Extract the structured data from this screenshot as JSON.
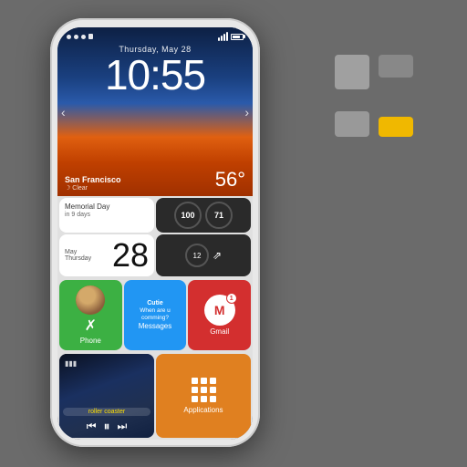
{
  "background_color": "#6b6b6b",
  "logo": {
    "blocks": [
      "gray-large",
      "gray-medium",
      "gray-small",
      "yellow"
    ]
  },
  "phone": {
    "status_bar": {
      "time": "10:55",
      "date": "Thursday, May 28",
      "signal": "4 bars",
      "wifi": true,
      "battery": "80%"
    },
    "clock": {
      "time": "10:55",
      "date": "Thursday, May 28"
    },
    "weather": {
      "city": "San Francisco",
      "condition": "Clear",
      "temperature": "56°"
    },
    "widgets": {
      "memorial": {
        "title": "Memorial Day",
        "subtitle": "in 9 days"
      },
      "date": {
        "day_name": "May",
        "day_sub": "Thursday",
        "number": "28"
      },
      "circles_top": {
        "val1": "100",
        "val2": "71"
      },
      "circles_bottom": {
        "val1": "12"
      }
    },
    "apps": {
      "phone": {
        "label": "Phone",
        "color": "#3cb043"
      },
      "messages": {
        "label": "Messages",
        "sender": "Cutie",
        "preview": "When are u comming?",
        "color": "#2196F3"
      },
      "gmail": {
        "label": "Gmail",
        "badge": "1",
        "color": "#d32f2f"
      }
    },
    "bottom": {
      "music": {
        "song": "roller coaster",
        "controls": [
          "prev",
          "play",
          "next"
        ]
      },
      "applications": {
        "label": "Applications",
        "color": "#e08020"
      }
    }
  }
}
